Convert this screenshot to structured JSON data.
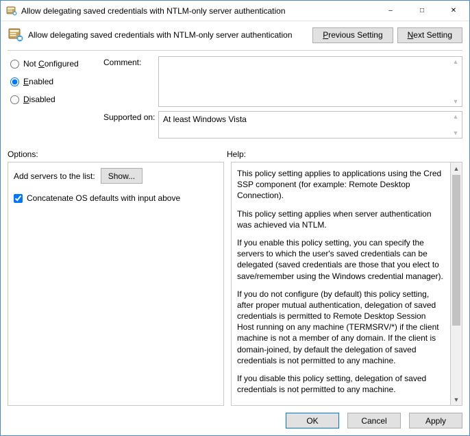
{
  "window": {
    "title": "Allow delegating saved credentials with NTLM-only server authentication"
  },
  "header": {
    "title": "Allow delegating saved credentials with NTLM-only server authentication",
    "prev_letter": "P",
    "prev_rest": "revious Setting",
    "next_letter": "N",
    "next_rest": "ext Setting"
  },
  "radios": {
    "not_configured_letter": "C",
    "not_configured_label": "Not ",
    "not_configured_rest": "onfigured",
    "enabled_letter": "E",
    "enabled_rest": "nabled",
    "disabled_letter": "D",
    "disabled_rest": "isabled",
    "selected": "enabled"
  },
  "fields": {
    "comment_label": "Comment:",
    "comment_value": "",
    "supported_label": "Supported on:",
    "supported_value": "At least Windows Vista"
  },
  "labels": {
    "options": "Options:",
    "help": "Help:"
  },
  "options_panel": {
    "add_servers_label": "Add servers to the list:",
    "show_button": "Show...",
    "checkbox_label": "Concatenate OS defaults with input above",
    "checkbox_checked": true
  },
  "help": {
    "p1": "This policy setting applies to applications using the Cred SSP component (for example: Remote Desktop Connection).",
    "p2": "This policy setting applies when server authentication was achieved via NTLM.",
    "p3": "If you enable this policy setting, you can specify the servers to which the user's saved credentials can be delegated (saved credentials are those that you elect to save/remember using the Windows credential manager).",
    "p4": "If you do not configure (by default) this policy setting, after proper mutual authentication, delegation of saved credentials is permitted to Remote Desktop Session Host running on any machine (TERMSRV/*) if the client machine is not a member of any domain. If the client is domain-joined, by default the delegation of saved credentials is not permitted to any machine.",
    "p5": "If you disable this policy setting, delegation of saved credentials is not permitted to any machine."
  },
  "footer": {
    "ok": "OK",
    "cancel": "Cancel",
    "apply": "Apply"
  }
}
